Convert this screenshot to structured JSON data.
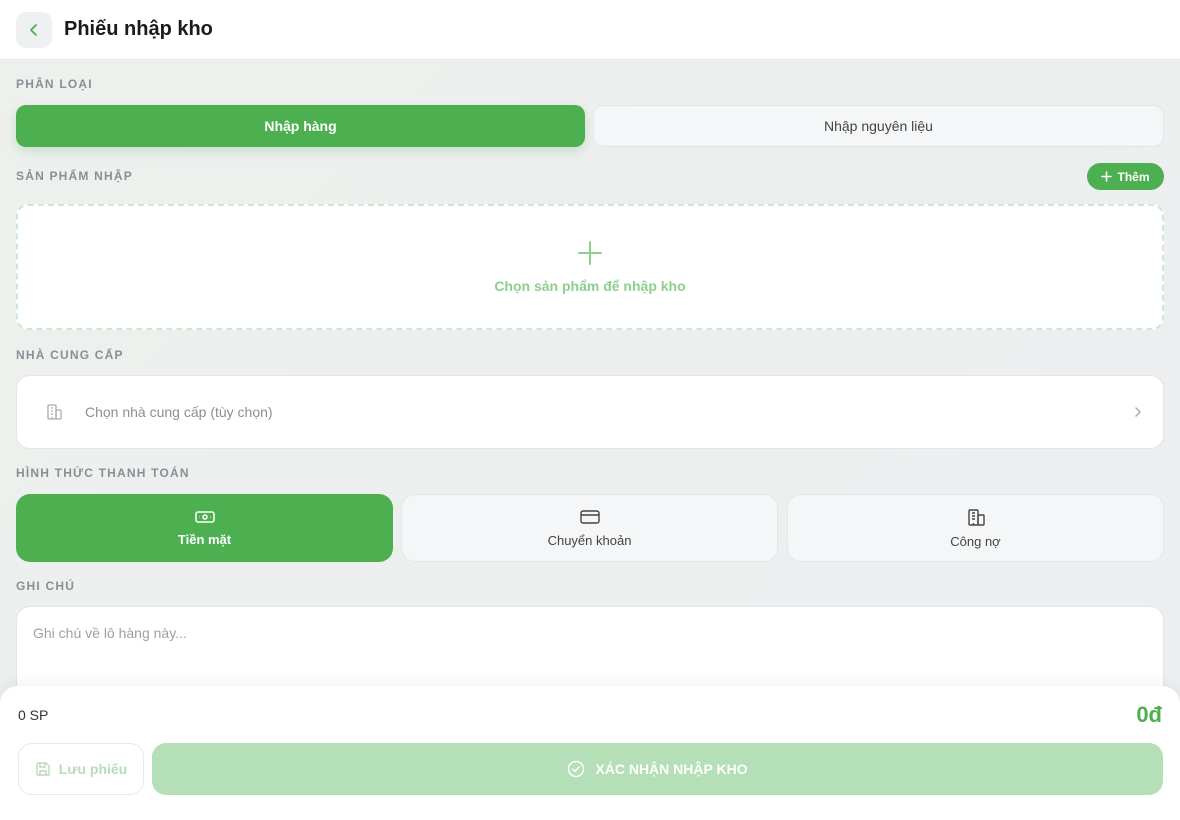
{
  "header": {
    "title": "Phiếu nhập kho",
    "back_icon": "chevron-left-icon"
  },
  "category": {
    "label": "PHÂN LOẠI",
    "options": [
      {
        "label": "Nhập hàng",
        "active": true
      },
      {
        "label": "Nhập nguyên liệu",
        "active": false
      }
    ]
  },
  "products": {
    "label": "SẢN PHẨM NHẬP",
    "add_label": "Thêm",
    "empty_text": "Chọn sản phẩm để nhập kho"
  },
  "supplier": {
    "label": "NHÀ CUNG CẤP",
    "placeholder": "Chọn nhà cung cấp (tùy chọn)"
  },
  "payment": {
    "label": "HÌNH THỨC THANH TOÁN",
    "options": [
      {
        "label": "Tiền mặt",
        "icon": "cash-icon",
        "active": true
      },
      {
        "label": "Chuyển khoản",
        "icon": "credit-card-icon",
        "active": false
      },
      {
        "label": "Công nợ",
        "icon": "building-icon",
        "active": false
      }
    ]
  },
  "notes": {
    "label": "GHI CHÚ",
    "placeholder": "Ghi chú về lô hàng này..."
  },
  "footer": {
    "count": "0 SP",
    "total": "0đ",
    "save_label": "Lưu phiếu",
    "confirm_label": "XÁC NHẬN NHẬP KHO"
  },
  "colors": {
    "accent": "#4caf50",
    "accent_disabled": "#b5dfb6"
  }
}
